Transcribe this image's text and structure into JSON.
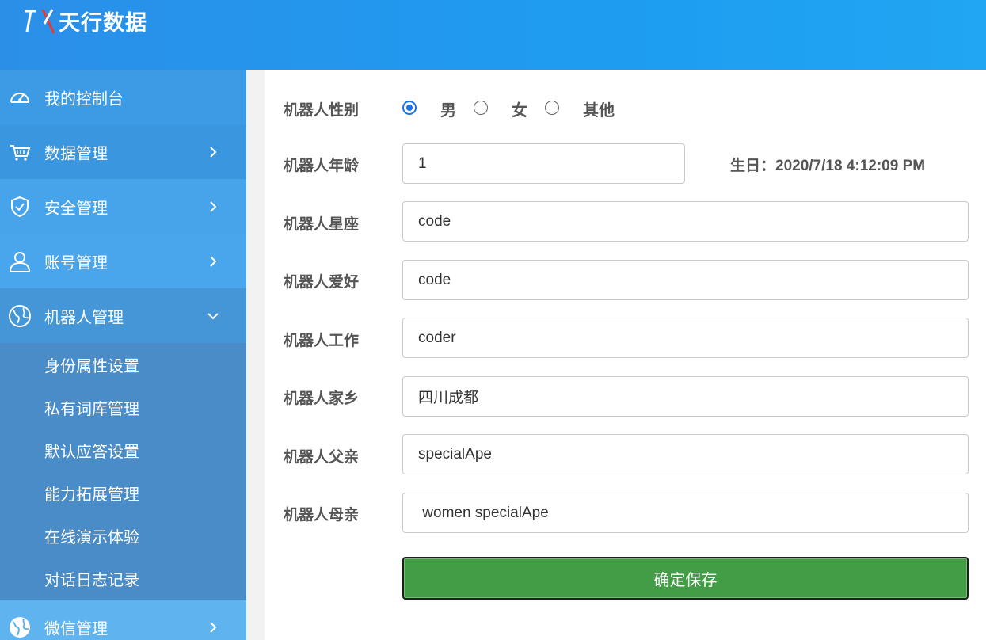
{
  "header": {
    "logo_text": "天行数据"
  },
  "sidebar": {
    "items": [
      {
        "label": "我的控制台",
        "icon": "dashboard-icon"
      },
      {
        "label": "数据管理",
        "icon": "cart-icon"
      },
      {
        "label": "安全管理",
        "icon": "shield-icon"
      },
      {
        "label": "账号管理",
        "icon": "user-icon"
      },
      {
        "label": "机器人管理",
        "icon": "globe-icon"
      },
      {
        "label": "微信管理",
        "icon": "globe-icon"
      }
    ],
    "submenu": [
      "身份属性设置",
      "私有词库管理",
      "默认应答设置",
      "能力拓展管理",
      "在线演示体验",
      "对话日志记录"
    ]
  },
  "form": {
    "gender": {
      "label": "机器人性别",
      "options": [
        "男",
        "女",
        "其他"
      ],
      "selected": "男"
    },
    "age": {
      "label": "机器人年龄",
      "value": "1"
    },
    "birthday": "生日：2020/7/18 4:12:09 PM",
    "constellation": {
      "label": "机器人星座",
      "value": "code"
    },
    "hobby": {
      "label": "机器人爱好",
      "value": "code"
    },
    "job": {
      "label": "机器人工作",
      "value": "coder"
    },
    "hometown": {
      "label": "机器人家乡",
      "value": "四川成都"
    },
    "father": {
      "label": "机器人父亲",
      "value": "specialApe"
    },
    "mother": {
      "label": "机器人母亲",
      "value": " women specialApe"
    },
    "save_label": "确定保存"
  },
  "colors": {
    "header": "#2196f3",
    "sidebar": "#3d9ae4",
    "submenu": "#4a8cc7",
    "save_button": "#439c46",
    "radio_checked": "#1a73e8"
  }
}
